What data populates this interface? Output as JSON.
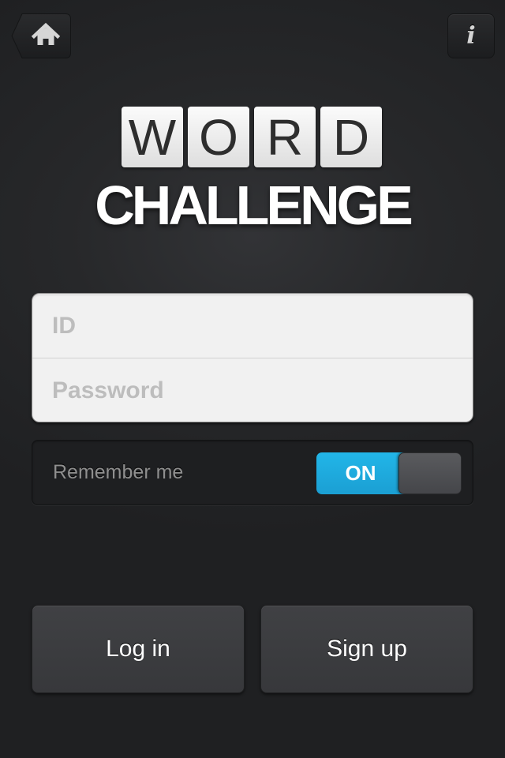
{
  "nav": {
    "home_icon": "home-icon",
    "info_icon": "info-icon",
    "info_glyph": "i"
  },
  "logo": {
    "tiles": [
      "W",
      "O",
      "R",
      "D"
    ],
    "subtitle": "CHALLENGE"
  },
  "login_form": {
    "id_placeholder": "ID",
    "id_value": "",
    "password_placeholder": "Password",
    "password_value": ""
  },
  "remember": {
    "label": "Remember me",
    "toggle_state": "ON",
    "on_color": "#1fa9de"
  },
  "actions": {
    "login_label": "Log in",
    "signup_label": "Sign up"
  }
}
